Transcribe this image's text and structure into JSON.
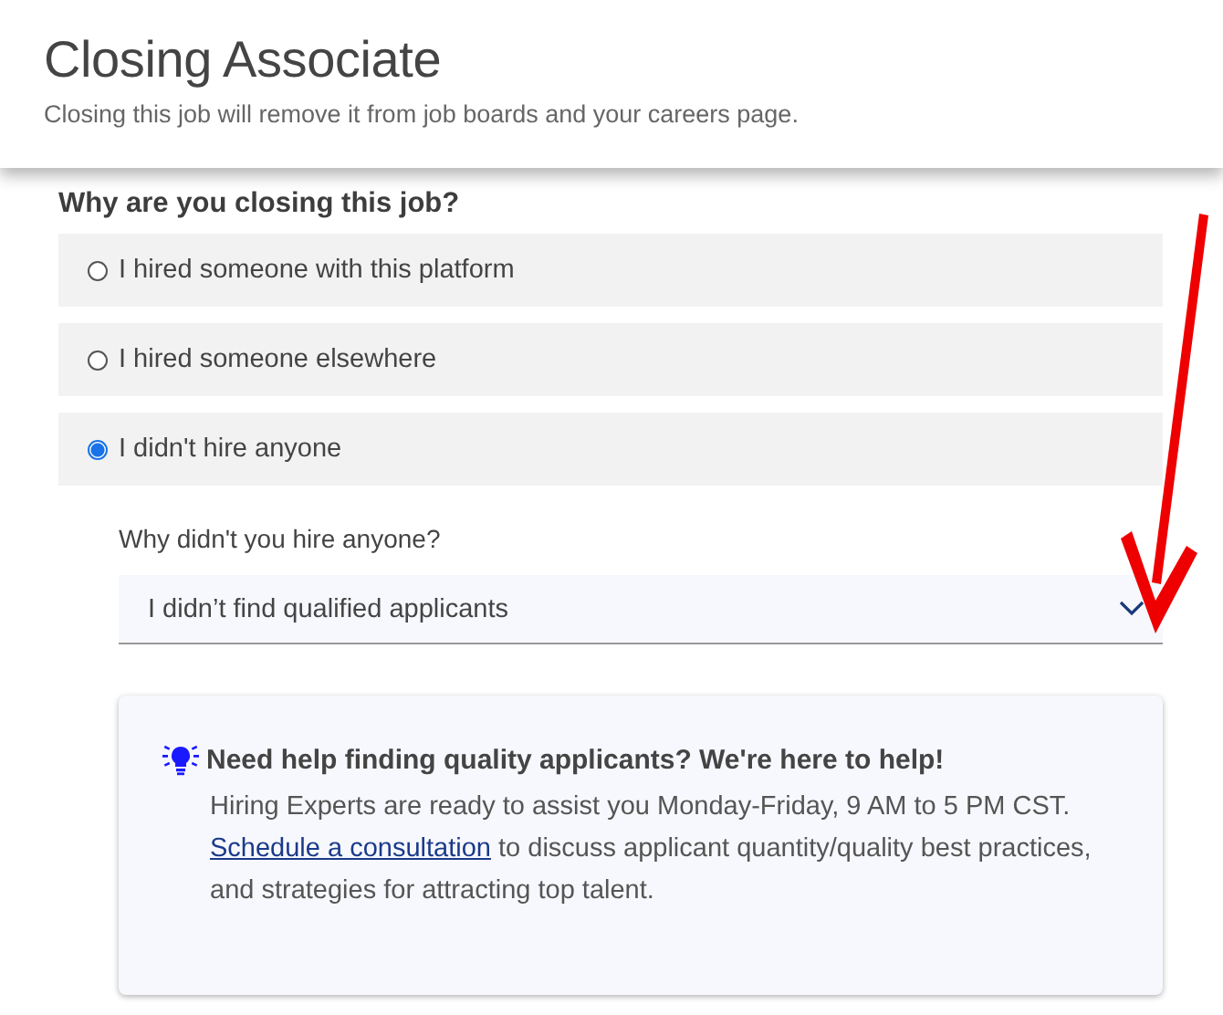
{
  "header": {
    "title": "Closing Associate",
    "subtitle": "Closing this job will remove it from job boards and your careers page."
  },
  "question": "Why are you closing this job?",
  "options": [
    {
      "label": "I hired someone with this platform",
      "selected": false
    },
    {
      "label": "I hired someone elsewhere",
      "selected": false
    },
    {
      "label": "I didn't hire anyone",
      "selected": true
    }
  ],
  "follow_up": {
    "label": "Why didn't you hire anyone?",
    "value": "I didn’t find qualified applicants"
  },
  "help_card": {
    "title": "Need help finding quality applicants? We're here to help!",
    "text_before": "Hiring Experts are ready to assist you Monday-Friday, 9 AM to 5 PM CST. ",
    "link": "Schedule a consultation",
    "text_after": " to discuss applicant quantity/quality best practices, and strategies for attracting top talent."
  },
  "annotation": {
    "kind": "arrow",
    "color": "#ee0000"
  }
}
